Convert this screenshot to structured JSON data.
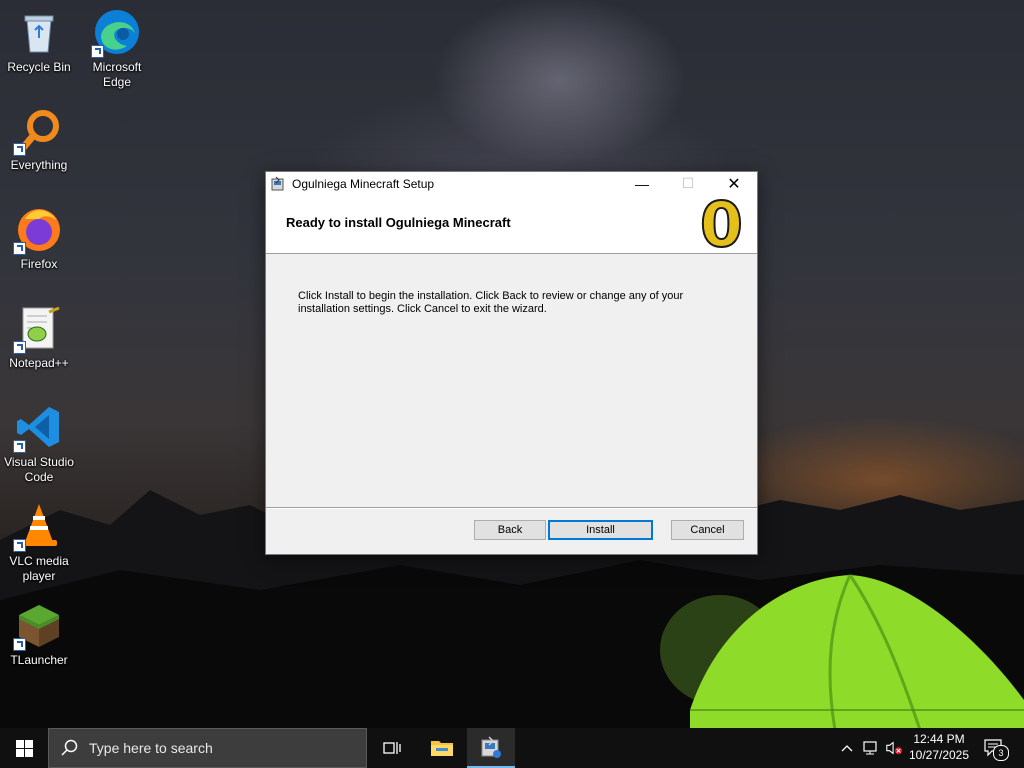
{
  "desktop": {
    "icons": [
      {
        "label": "Recycle Bin"
      },
      {
        "label": "Microsoft Edge"
      },
      {
        "label": "Everything"
      },
      {
        "label": "Firefox"
      },
      {
        "label": "Notepad++"
      },
      {
        "label": "Visual Studio Code"
      },
      {
        "label": "VLC media player"
      },
      {
        "label": "TLauncher"
      }
    ]
  },
  "dialog": {
    "title": "Ogulniega Minecraft Setup",
    "heading": "Ready to install Ogulniega Minecraft",
    "logo_glyph": "0",
    "body": "Click Install to begin the installation. Click Back to review or change any of your installation settings. Click Cancel to exit the wizard.",
    "buttons": {
      "back": "Back",
      "install": "Install",
      "cancel": "Cancel"
    },
    "controls": {
      "minimize": "—",
      "maximize": "☐",
      "close": "✕"
    }
  },
  "taskbar": {
    "search_placeholder": "Type here to search",
    "time": "12:44 PM",
    "date": "10/27/2025",
    "notification_count": "3"
  },
  "colors": {
    "accent": "#0078d7",
    "taskbar": "#101010",
    "tent": "#8fdb2a"
  }
}
